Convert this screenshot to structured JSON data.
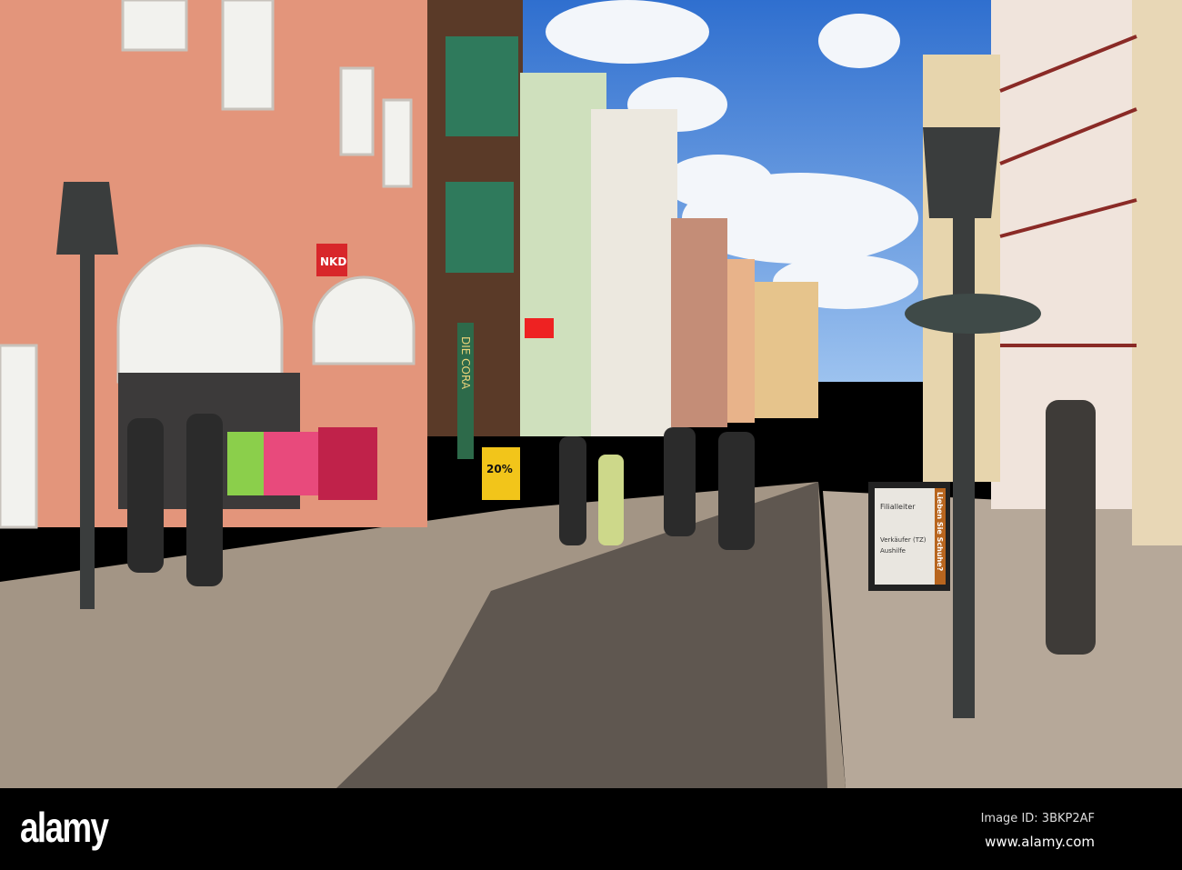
{
  "photo": {
    "signs": {
      "nkd": "NKD",
      "sale": "20%",
      "vodafone": "●",
      "board_side": "Lieben Sie Schuhe?",
      "board_items": [
        "Filialleiter",
        "Verkäufer (TZ)",
        "Aushilfe"
      ],
      "awning": "DIE CORA"
    },
    "colors": {
      "sky": "#3f7fd4",
      "pink_building": "#e79a7f",
      "pavement": "#9b8f83"
    }
  },
  "banner": {
    "logo": "alamy",
    "image_id": "Image ID: 3BKP2AF",
    "url": "www.alamy.com"
  }
}
